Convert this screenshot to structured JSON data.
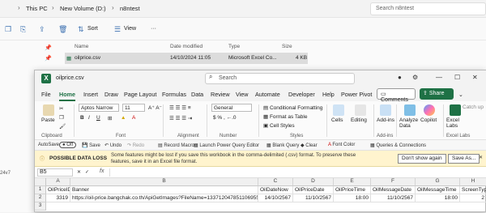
{
  "explorer": {
    "breadcrumbs": [
      "This PC",
      "New Volume (D:)",
      "n8ntest"
    ],
    "search_placeholder": "Search n8ntest",
    "toolbar": {
      "sort_label": "Sort",
      "view_label": "View",
      "more_label": "···"
    },
    "columns": [
      "Name",
      "Date modified",
      "Type",
      "Size"
    ],
    "file": {
      "name": "oilprice.csv",
      "date": "14/10/2024 11:05",
      "type": "Microsoft Excel Co...",
      "size": "4 KB"
    },
    "left_fragment": "24v7"
  },
  "excel": {
    "filename": "oilprice.csv",
    "search_placeholder": "Search",
    "menu": [
      "File",
      "Home",
      "Insert",
      "Draw",
      "Page Layout",
      "Formulas",
      "Data",
      "Review",
      "View",
      "Automate",
      "Developer",
      "Help",
      "Power Pivot"
    ],
    "active_menu": "Home",
    "comments_label": "Comments",
    "share_label": "Share",
    "ribbon": {
      "paste": "Paste",
      "clipboard": "Clipboard",
      "font_name": "Aptos Narrow",
      "font_size": "11",
      "font": "Font",
      "alignment": "Alignment",
      "number_format": "General",
      "number": "Number",
      "conditional": "Conditional Formatting",
      "format_table": "Format as Table",
      "cell_styles": "Cell Styles",
      "styles": "Styles",
      "cells": "Cells",
      "editing": "Editing",
      "addins": "Add-ins",
      "addins_group": "Add-ins",
      "analyze": "Analyze Data",
      "copilot": "Copilot",
      "catch_up": "Catch up",
      "excel_labs": "Excel Labs",
      "excel_labs_group": "Excel Labs"
    },
    "quick_access": [
      "AutoSave",
      "Off",
      "Save",
      "Undo",
      "Redo",
      "Record Macro",
      "Launch Power Query Editor",
      "Blank Query",
      "Clear",
      "Font Color",
      "Queries & Connections"
    ],
    "warning": {
      "title": "POSSIBLE DATA LOSS",
      "message": "Some features might be lost if you save this workbook in the comma-delimited (.csv) format. To preserve these features, save it in an Excel file format.",
      "dont_show": "Don't show again",
      "save_as": "Save As..."
    },
    "namebox": "B5",
    "fx": "fx",
    "columns": [
      "A",
      "B",
      "C",
      "D",
      "E",
      "F",
      "G",
      "H"
    ],
    "rows": [
      [
        "OilPriceID",
        "Banner",
        "OilDateNow",
        "OilPriceDate",
        "OilPriceTime",
        "OilMessageDate",
        "OilMessageTime",
        "ScreenType"
      ],
      [
        "3319",
        "https://oil-price.bangchak.co.th/ApiGetImages?FileName=133712047851106955.jpg",
        "14/10/2567",
        "11/10/2567",
        "18:00",
        "11/10/2567",
        "18:00",
        "2"
      ]
    ]
  }
}
